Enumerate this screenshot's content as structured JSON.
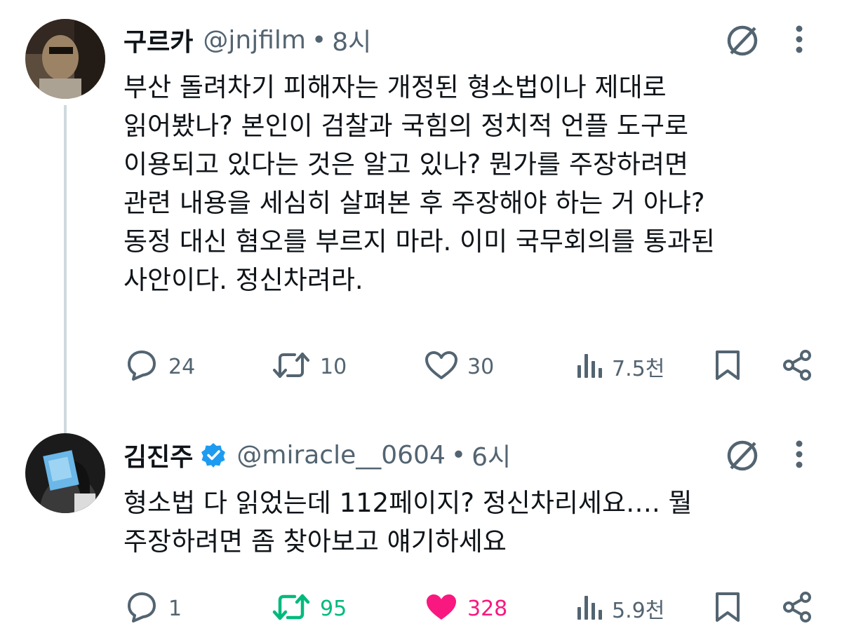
{
  "tweets": [
    {
      "name": "구르카",
      "handle": "@jnjfilm",
      "separator": "•",
      "time": "8시",
      "verified": false,
      "text": "부산 돌려차기 피해자는 개정된 형소법이나 제대로\n읽어봤나? 본인이 검찰과 국힘의 정치적 언플  도구로\n이용되고 있다는 것은 알고 있나? 뭔가를 주장하려면\n관련 내용을 세심히 살펴본 후 주장해야 하는 거 아냐?\n동정 대신 혐오를 부르지 마라. 이미 국무회의를 통과된\n사안이다. 정신차려라.",
      "replies": "24",
      "retweets": "10",
      "likes": "30",
      "views": "7.5천",
      "retweeted": false,
      "liked": false
    },
    {
      "name": "김진주",
      "handle": "@miracle__0604",
      "separator": "•",
      "time": "6시",
      "verified": true,
      "text": "형소법 다 읽었는데 112페이지? 정신차리세요…. 뭘\n주장하려면 좀 찾아보고 얘기하세요",
      "replies": "1",
      "retweets": "95",
      "likes": "328",
      "views": "5.9천",
      "retweeted": true,
      "liked": true
    }
  ],
  "colors": {
    "text": "#0f1419",
    "secondary": "#536471",
    "thread_line": "#cfd9de",
    "verified": "#1d9bf0",
    "retweet_active": "#00ba7c",
    "like_active": "#f91880"
  },
  "icons": [
    "reply-icon",
    "retweet-icon",
    "like-icon",
    "views-icon",
    "bookmark-icon",
    "share-icon",
    "grok-icon",
    "more-icon",
    "verified-badge-icon"
  ]
}
